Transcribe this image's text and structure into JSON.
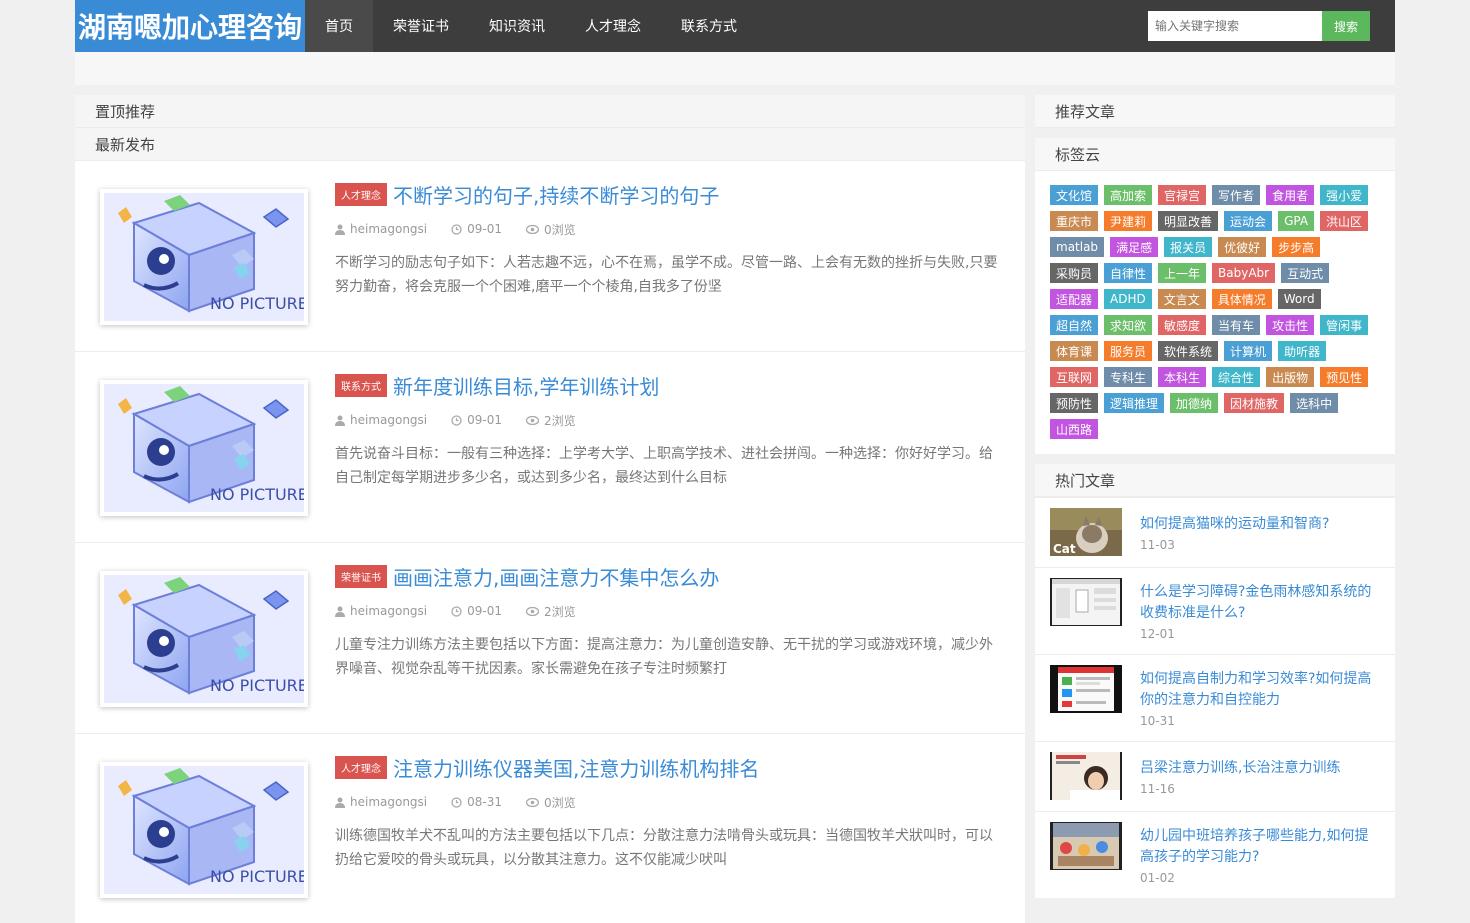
{
  "site": {
    "logo": "湖南嗯加心理咨询",
    "nav": [
      {
        "label": "首页",
        "active": true
      },
      {
        "label": "荣誉证书",
        "active": false
      },
      {
        "label": "知识资讯",
        "active": false
      },
      {
        "label": "人才理念",
        "active": false
      },
      {
        "label": "联系方式",
        "active": false
      }
    ],
    "search": {
      "placeholder": "输入关键字搜索",
      "button": "搜索"
    }
  },
  "main": {
    "pinned_label": "置顶推荐",
    "latest_label": "最新发布",
    "thumb_text": "NO PICTURE",
    "posts": [
      {
        "category": "人才理念",
        "title": "不断学习的句子,持续不断学习的句子",
        "author": "heimagongsi",
        "date": "09-01",
        "views": "0浏览",
        "excerpt": "不断学习的励志句子如下：人若志趣不远，心不在焉，虽学不成。尽管一路、上会有无数的挫折与失败,只要努力勤奋，将会克服一个个困难,磨平一个个棱角,自我多了份坚"
      },
      {
        "category": "联系方式",
        "title": "新年度训练目标,学年训练计划",
        "author": "heimagongsi",
        "date": "09-01",
        "views": "2浏览",
        "excerpt": "首先说奋斗目标：一般有三种选择：上学考大学、上职高学技术、进社会拼闯。一种选择：你好好学习。给自己制定每学期进步多少名，或达到多少名，最终达到什么目标"
      },
      {
        "category": "荣誉证书",
        "title": "画画注意力,画画注意力不集中怎么办",
        "author": "heimagongsi",
        "date": "09-01",
        "views": "2浏览",
        "excerpt": "儿童专注力训练方法主要包括以下方面：提高注意力：为儿童创造安静、无干扰的学习或游戏环境，减少外界噪音、视觉杂乱等干扰因素。家长需避免在孩子专注时频繁打"
      },
      {
        "category": "人才理念",
        "title": "注意力训练仪器美国,注意力训练机构排名",
        "author": "heimagongsi",
        "date": "08-31",
        "views": "0浏览",
        "excerpt": "训练德国牧羊犬不乱叫的方法主要包括以下几点：分散注意力法啃骨头或玩具：当德国牧羊犬狀叫时，可以扔给它爱咬的骨头或玩具，以分散其注意力。这不仅能减少吠叫"
      }
    ]
  },
  "sidebar": {
    "recommend_label": "推荐文章",
    "tags_label": "标签云",
    "tags": [
      {
        "text": "文化馆",
        "color": "#4a9fd4"
      },
      {
        "text": "高加索",
        "color": "#6cbf6a"
      },
      {
        "text": "官禄宫",
        "color": "#e06666"
      },
      {
        "text": "写作者",
        "color": "#6f8ca8"
      },
      {
        "text": "食用者",
        "color": "#c255e0"
      },
      {
        "text": "强小爱",
        "color": "#3fb6c9"
      },
      {
        "text": "重庆市",
        "color": "#c98a52"
      },
      {
        "text": "尹建莉",
        "color": "#f57c2b"
      },
      {
        "text": "明显改善",
        "color": "#666666"
      },
      {
        "text": "运动会",
        "color": "#4a9fd4"
      },
      {
        "text": "GPA",
        "color": "#6cbf6a"
      },
      {
        "text": "洪山区",
        "color": "#e06666"
      },
      {
        "text": "matlab",
        "color": "#6f8ca8"
      },
      {
        "text": "满足感",
        "color": "#c255e0"
      },
      {
        "text": "报关员",
        "color": "#3fb6c9"
      },
      {
        "text": "优彼好",
        "color": "#c98a52"
      },
      {
        "text": "步步高",
        "color": "#f57c2b"
      },
      {
        "text": "采购员",
        "color": "#666666"
      },
      {
        "text": "自律性",
        "color": "#4a9fd4"
      },
      {
        "text": "上一年",
        "color": "#6cbf6a"
      },
      {
        "text": "BabyAbr",
        "color": "#e06666"
      },
      {
        "text": "互动式",
        "color": "#6f8ca8"
      },
      {
        "text": "适配器",
        "color": "#c255e0"
      },
      {
        "text": "ADHD",
        "color": "#3fb6c9"
      },
      {
        "text": "文言文",
        "color": "#c98a52"
      },
      {
        "text": "具体情况",
        "color": "#f57c2b"
      },
      {
        "text": "Word",
        "color": "#666666"
      },
      {
        "text": "超自然",
        "color": "#4a9fd4"
      },
      {
        "text": "求知欲",
        "color": "#6cbf6a"
      },
      {
        "text": "敏感度",
        "color": "#e06666"
      },
      {
        "text": "当有车",
        "color": "#6f8ca8"
      },
      {
        "text": "攻击性",
        "color": "#c255e0"
      },
      {
        "text": "管闲事",
        "color": "#3fb6c9"
      },
      {
        "text": "体育课",
        "color": "#c98a52"
      },
      {
        "text": "服务员",
        "color": "#f57c2b"
      },
      {
        "text": "软件系统",
        "color": "#666666"
      },
      {
        "text": "计算机",
        "color": "#4a9fd4"
      },
      {
        "text": "助听器",
        "color": "#3fb6c9"
      },
      {
        "text": "互联网",
        "color": "#e06666"
      },
      {
        "text": "专科生",
        "color": "#6f8ca8"
      },
      {
        "text": "本科生",
        "color": "#c255e0"
      },
      {
        "text": "综合性",
        "color": "#3fb6c9"
      },
      {
        "text": "出版物",
        "color": "#c98a52"
      },
      {
        "text": "预见性",
        "color": "#f57c2b"
      },
      {
        "text": "预防性",
        "color": "#666666"
      },
      {
        "text": "逻辑推理",
        "color": "#4a9fd4"
      },
      {
        "text": "加德纳",
        "color": "#6cbf6a"
      },
      {
        "text": "因材施教",
        "color": "#e06666"
      },
      {
        "text": "选科中",
        "color": "#6f8ca8"
      },
      {
        "text": "山西路",
        "color": "#c255e0"
      }
    ],
    "hot_label": "热门文章",
    "hot": [
      {
        "title": "如何提高猫咪的运动量和智商?",
        "date": "11-03",
        "thumb": "cat",
        "thumb_text": "Cat"
      },
      {
        "title": "什么是学习障碍?金色雨林感知系统的收费标准是什么?",
        "date": "12-01",
        "thumb": "screen"
      },
      {
        "title": "如何提高自制力和学习效率?如何提高你的注意力和自控能力",
        "date": "10-31",
        "thumb": "app"
      },
      {
        "title": "吕梁注意力训练,长治注意力训练",
        "date": "11-16",
        "thumb": "child"
      },
      {
        "title": "幼儿园中班培养孩子哪些能力,如何提高孩子的学习能力?",
        "date": "01-02",
        "thumb": "class"
      }
    ]
  }
}
